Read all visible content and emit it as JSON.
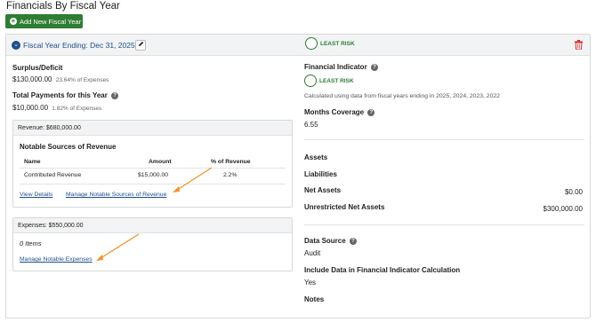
{
  "page": {
    "title": "Financials By Fiscal Year"
  },
  "toolbar": {
    "add_label": "Add New Fiscal Year"
  },
  "fiscal_year": {
    "title": "Fiscal Year Ending: Dec 31, 2025",
    "risk_label": "LEAST RISK",
    "accent": "#2e7d32",
    "delete_color": "#d32f2f"
  },
  "left": {
    "surplus_label": "Surplus/Deficit",
    "surplus_value": "$130,000.00",
    "surplus_pct": "23.64% of Expenses",
    "payments_label": "Total Payments for this Year",
    "payments_value": "$10,000.00",
    "payments_pct": "1.82% of Expenses"
  },
  "revenue": {
    "header": "Revenue: $680,000.00",
    "section_title": "Notable Sources of Revenue",
    "columns": [
      "Name",
      "Amount",
      "% of Revenue"
    ],
    "rows": [
      {
        "name": "Contributed Revenue",
        "amount": "$15,000.00",
        "pct": "2.2%"
      }
    ],
    "view_details": "View Details",
    "manage": "Manage Notable Sources of Revenue"
  },
  "expenses": {
    "header": "Expenses: $550,000.00",
    "items": "0 Items",
    "manage": "Manage Notable Expenses"
  },
  "right": {
    "indicator_label": "Financial Indicator",
    "indicator_value": "LEAST RISK",
    "indicator_note": "Calculated using data from fiscal years ending in 2025, 2024, 2023, 2022",
    "months_label": "Months Coverage",
    "months_value": "6.55",
    "assets_label": "Assets",
    "liabilities_label": "Liabilities",
    "net_assets_label": "Net Assets",
    "net_assets_value": "$0.00",
    "unrestricted_label": "Unrestricted Net Assets",
    "unrestricted_value": "$300,000.00",
    "source_label": "Data Source",
    "source_value": "Audit",
    "include_label": "Include Data in Financial Indicator Calculation",
    "include_value": "Yes",
    "notes_label": "Notes"
  },
  "icons": {
    "add": "plus-circle-icon",
    "collapse": "chevron-down-icon",
    "edit": "pencil-icon",
    "delete": "trash-icon",
    "help": "question-circle-icon",
    "annotation": "arrow-annotation"
  }
}
